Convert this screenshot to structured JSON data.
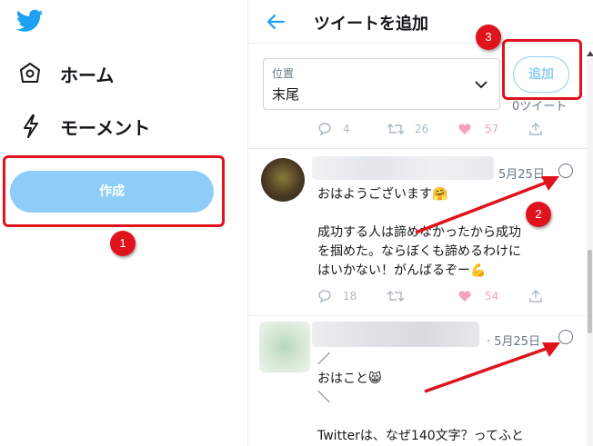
{
  "sidebar": {
    "items": [
      {
        "label": "ホーム",
        "icon": "home-icon"
      },
      {
        "label": "モーメント",
        "icon": "lightning-icon"
      }
    ],
    "compose_label": "作成"
  },
  "header": {
    "title": "ツイートを追加"
  },
  "position_select": {
    "label": "位置",
    "value": "末尾"
  },
  "add_button_label": "追加",
  "tweet_count_label": "0ツイート",
  "top_actions": {
    "replies": "4",
    "retweets": "26",
    "likes": "57"
  },
  "tweets": [
    {
      "date": "5月25日",
      "text": "おはようございます🤗\n\n成功する人は諦めなかったから成功\nを掴めた。ならぼくも諦めるわけに\nはいかない！がんばるぞー💪",
      "replies": "18",
      "likes": "54"
    },
    {
      "date": "· 5月25日",
      "text": "／\nおはこと😸\n＼\n\nTwitterは、なぜ140文字？ってふと"
    }
  ],
  "annotations": [
    "1",
    "2",
    "3"
  ],
  "colors": {
    "accent": "#1da1f2",
    "compose_bg": "#8ecdf8",
    "annotation": "#e0121c",
    "like": "#e0245e"
  }
}
